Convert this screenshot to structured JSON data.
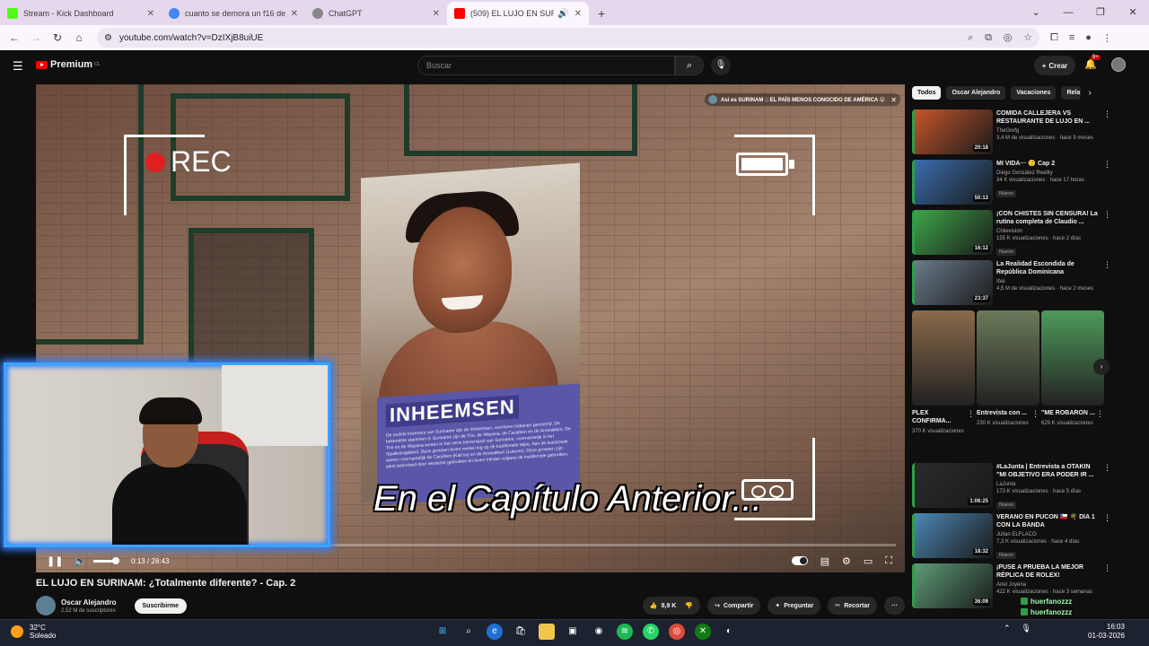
{
  "browser": {
    "tabs": [
      {
        "title": "Stream - Kick Dashboard",
        "favicon_color": "#53fc18",
        "active": false
      },
      {
        "title": "cuanto se demora un f16 desde",
        "favicon_color": "#4285f4",
        "active": false
      },
      {
        "title": "ChatGPT",
        "favicon_color": "#888888",
        "active": false
      },
      {
        "title": "(509) EL LUJO EN SURINAM",
        "favicon_color": "#ff0000",
        "active": true
      }
    ],
    "url": "youtube.com/watch?v=DzIXjB8uiUE"
  },
  "youtube": {
    "logo_text": "Premium",
    "logo_region": "CL",
    "search_placeholder": "Buscar",
    "create_label": "Crear",
    "notification_count": "9+"
  },
  "player": {
    "card_text": "Así es SURINAM :: EL PAÍS MENOS CONOCIDO DE AMÉRICA 😮",
    "rec_label": "REC",
    "caption": "En el Capítulo Anterior...",
    "poster_title": "INHEEMSEN",
    "poster_text": "De oudste inwoners van Suriname zijn de inheemsen, voorheen Indianen genoemd. De bekendste stammen in Suriname zijn de Trio, de Wayana, de Caraïben en de Arowakken. De Trio en de Wayana wonen in het verre binnenland van Suriname, voornamelijk in het Sipaliwinigebied. Deze groepen leven veelal nog op de traditionele wijze. Aan de kuststreek wonen voornamelijk de Caraïben (Kali'na) en de Arowakken (Lokono). Deze groepen zijn sterk beïnvloed door westerse gebruiken en leven minder volgens de traditionele gebruiken.",
    "time": "0:13 / 28:43",
    "progress_fraction": 0.008
  },
  "video": {
    "title": "EL LUJO EN SURINAM: ¿Totalmente diferente? - Cap. 2",
    "channel": "Oscar Alejandro",
    "subscribers": "2,52 M de suscriptores",
    "subscribe_label": "Suscribirme",
    "likes": "8,9 K",
    "share_label": "Compartir",
    "ask_label": "Preguntar",
    "clip_label": "Recortar"
  },
  "sidebar": {
    "chips": [
      "Todos",
      "Oscar Alejandro",
      "Vacaciones",
      "Rela"
    ],
    "related": [
      {
        "title": "COMIDA CALLEJERA VS RESTAURANTE DE LUJO EN ...",
        "channel": "TheGrefg",
        "stats": "3,4 M de visualizaciones · hace 9 meses",
        "duration": "20:18",
        "badge": "",
        "color": "#c9572b"
      },
      {
        "title": "MI VIDA··· 🙂 Cap 2",
        "channel": "Diego González Reality",
        "stats": "34 K visualizaciones · hace 17 horas",
        "duration": "50:13",
        "badge": "Nuevo",
        "color": "#3a6fb0"
      },
      {
        "title": "¡CON CHISTES SIN CENSURA! La rutina completa de Claudio ...",
        "channel": "Chilevisión",
        "stats": "155 K visualizaciones · hace 2 días",
        "duration": "16:12",
        "badge": "Nuevo",
        "color": "#3ea84a"
      },
      {
        "title": "La Realidad Escondida de República Dominicana",
        "channel": "Ibai",
        "stats": "4,5 M de visualizaciones · hace 2 meses",
        "duration": "23:37",
        "badge": "",
        "color": "#6b7d8e"
      },
      {
        "title": "#LaJunta | Entrevista a OTAKIN \"MI OBJETIVO ERA PODER IR ...",
        "channel": "LaJunta",
        "stats": "173 K visualizaciones · hace 5 días",
        "duration": "1:06:25",
        "badge": "Nuevo",
        "color": "#2b2b2b"
      },
      {
        "title": "VERANO EN PUCON 🇨🇱 🌴 DIA 1 CON LA BANDA",
        "channel": "Julian ELFLACO",
        "stats": "7,3 K visualizaciones · hace 4 días",
        "duration": "18:32",
        "badge": "Nuevo",
        "color": "#4b8ab8"
      },
      {
        "title": "¡PUSE A PRUEBA LA MEJOR RÉPLICA DE ROLEX!",
        "channel": "Ariel Joyeria",
        "stats": "422 K visualizaciones · hace 3 semanas",
        "duration": "36:09",
        "badge": "",
        "color": "#5e9e78"
      }
    ],
    "shorts": [
      {
        "title": "PLEX CONFIRMA...",
        "views": "370 K visualizaciones",
        "color": "#8a6a4a"
      },
      {
        "title": "Entrevista con ...",
        "views": "230 K visualizaciones",
        "color": "#6a7a5a"
      },
      {
        "title": "\"ME ROBARON ...",
        "views": "629 K visualizaciones",
        "color": "#4e9a5a"
      }
    ]
  },
  "taskbar": {
    "temperature": "32°C",
    "weather": "Soleado",
    "time": "16:03",
    "date": "01-03-2026"
  },
  "chat": [
    {
      "name": "huerfanozzz"
    },
    {
      "name": "huerfanozzz"
    }
  ]
}
